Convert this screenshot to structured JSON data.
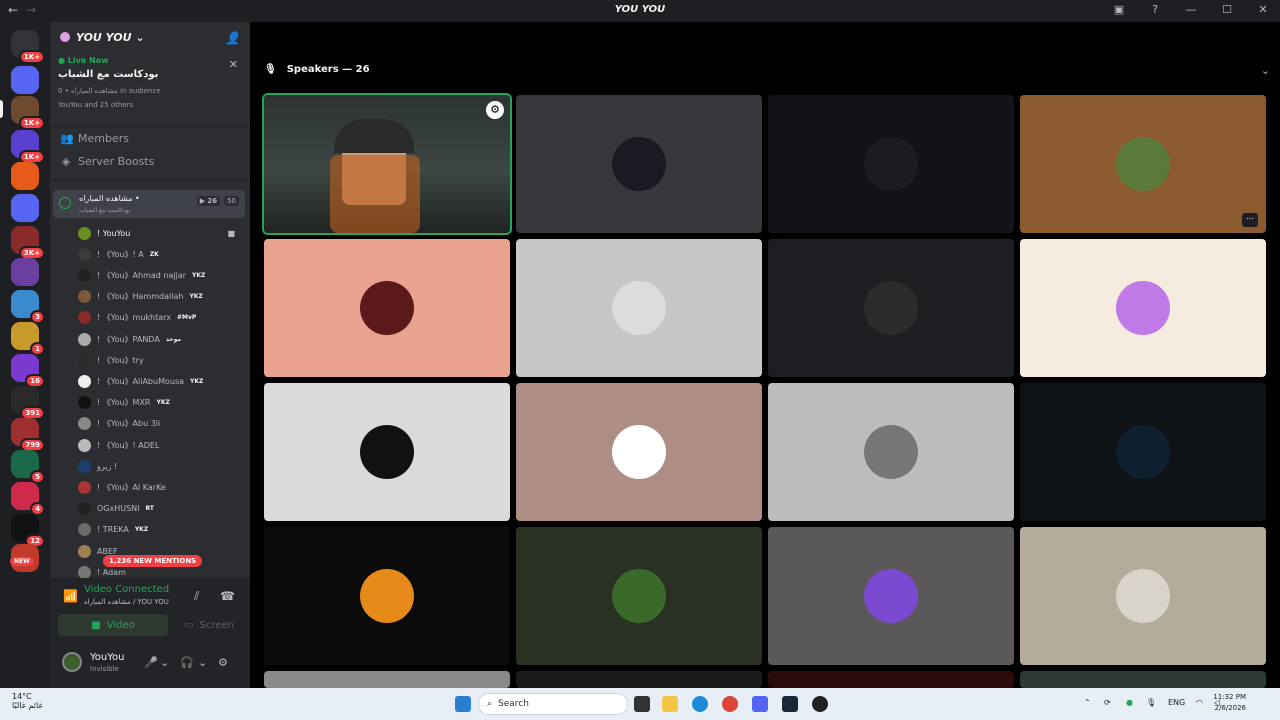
{
  "window": {
    "title": "YOU YOU"
  },
  "server": {
    "name": "YOU YOU",
    "live": {
      "label": "Live Now",
      "title": "بودكاست مع الشباب",
      "meta": "مشاهده المباراه • 0 in audience",
      "people": "YouYou and 25 others"
    },
    "nav": [
      {
        "label": "Members",
        "icon": "members-icon"
      },
      {
        "label": "Server Boosts",
        "icon": "boost-icon"
      }
    ],
    "voice_channel": {
      "name": "مشاهده المباراه •",
      "subtitle": "بودكاست مع الشباب",
      "video_count": "26",
      "limit": "50"
    },
    "members": [
      {
        "name": "! YouYou",
        "tag": "",
        "color": "#6b8e23"
      },
      {
        "name": "! 《You》! A",
        "tag": "ZK",
        "color": "#3a3a3a"
      },
      {
        "name": "! 《You》Ahmad najjar",
        "tag": "YKZ",
        "color": "#222"
      },
      {
        "name": "! 《You》Hammdallah",
        "tag": "YKZ",
        "color": "#7a5a3a"
      },
      {
        "name": "! 《You》mukhtarx",
        "tag": "#MvP",
        "color": "#8b2a2a"
      },
      {
        "name": "! 《You》PANDA",
        "tag": "موحد",
        "color": "#aaaaaa"
      },
      {
        "name": "! 《You》try",
        "tag": "",
        "color": "#2a2a2a"
      },
      {
        "name": "! 《You》AliAbuMousa",
        "tag": "YKZ",
        "color": "#eeeeee"
      },
      {
        "name": "! 《You》MXR",
        "tag": "YKZ",
        "color": "#111"
      },
      {
        "name": "! 《You》Abu 3li",
        "tag": "",
        "color": "#888"
      },
      {
        "name": "! 《You》! ADEL",
        "tag": "",
        "color": "#bbbbbb"
      },
      {
        "name": "زيرو !",
        "tag": "",
        "color": "#1d3f6b"
      },
      {
        "name": "! 《You》Al KarKe",
        "tag": "",
        "color": "#a33"
      },
      {
        "name": "OGxHUSNI",
        "tag": "RT",
        "color": "#222"
      },
      {
        "name": "! TREKA",
        "tag": "YKZ",
        "color": "#6a6a6a"
      },
      {
        "name": "ABEF",
        "tag": "",
        "color": "#a08050"
      },
      {
        "name": "! Adam",
        "tag": "",
        "color": "#777"
      }
    ],
    "mentions": "1,236 NEW MENTIONS"
  },
  "voice_panel": {
    "status": "Video Connected",
    "channel": "مشاهده المباراه / YOU YOU",
    "video_label": "Video",
    "screen_label": "Screen"
  },
  "user": {
    "name": "YouYou",
    "status": "Invisible"
  },
  "stage": {
    "header": "Speakers — 26",
    "tiles": [
      {
        "bg": "#3a3a3a",
        "selected": true,
        "video": true
      },
      {
        "bg": "#38373b",
        "pfp": "#1a1a22"
      },
      {
        "bg": "#121316",
        "pfp": "#1b1c1f"
      },
      {
        "bg": "#8b5a2f",
        "pfp": "#5a7a3a",
        "more": true
      },
      {
        "bg": "#e9a28f",
        "pfp": "#5a1a1a"
      },
      {
        "bg": "#c5c7c8",
        "pfp": "#dcdcdc"
      },
      {
        "bg": "#1d1e21",
        "pfp": "#2c2c2e"
      },
      {
        "bg": "#f5ecdf",
        "pfp": "#c07ae8"
      },
      {
        "bg": "#dadada",
        "pfp": "#111"
      },
      {
        "bg": "#ae8d84",
        "pfp": "#fff"
      },
      {
        "bg": "#bdbdbe",
        "pfp": "#777"
      },
      {
        "bg": "#0f1316",
        "pfp": "#0f2030"
      },
      {
        "bg": "#0b0b0c",
        "pfp": "#e68a1a"
      },
      {
        "bg": "#2b3122",
        "pfp": "#3a6a2a"
      },
      {
        "bg": "#5a5859",
        "pfp": "#7a4ad0"
      },
      {
        "bg": "#b4ab9b",
        "pfp": "#d9d4c9"
      }
    ]
  },
  "taskbar": {
    "weather_temp": "14°C",
    "weather_desc": "غائم غالبًا",
    "search_placeholder": "Search",
    "lang": "ENG",
    "time": "11:32 PM",
    "date": "2/6/2026"
  }
}
